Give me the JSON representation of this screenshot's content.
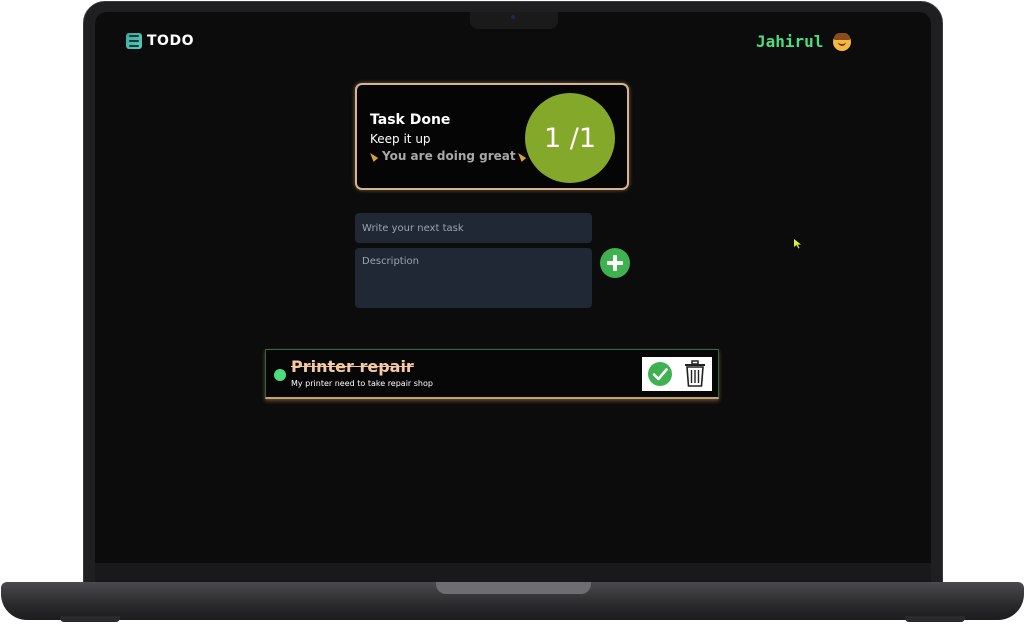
{
  "header": {
    "brand_name": "TODO",
    "brand_icon": "todo-list-icon",
    "user_name": "Jahirul",
    "avatar_icon": "man-emoji-icon"
  },
  "stats": {
    "title": "Task Done",
    "subtitle": "Keep it up",
    "cheer": "You are doing great",
    "cheer_icon": "party-popper-icon",
    "progress": "1 /1",
    "completed": 1,
    "total": 1
  },
  "form": {
    "task_placeholder": "Write your next task",
    "description_placeholder": "Description",
    "add_icon": "plus-icon"
  },
  "tasks": [
    {
      "title": "Printer repair",
      "description": "My printer need to take repair shop",
      "done": true,
      "complete_icon": "check-circle-icon",
      "delete_icon": "trash-icon"
    }
  ],
  "colors": {
    "accent_green": "#4ade80",
    "progress_green": "#84a82a",
    "card_border": "#d9b48a",
    "background": "#0c0c0c"
  }
}
